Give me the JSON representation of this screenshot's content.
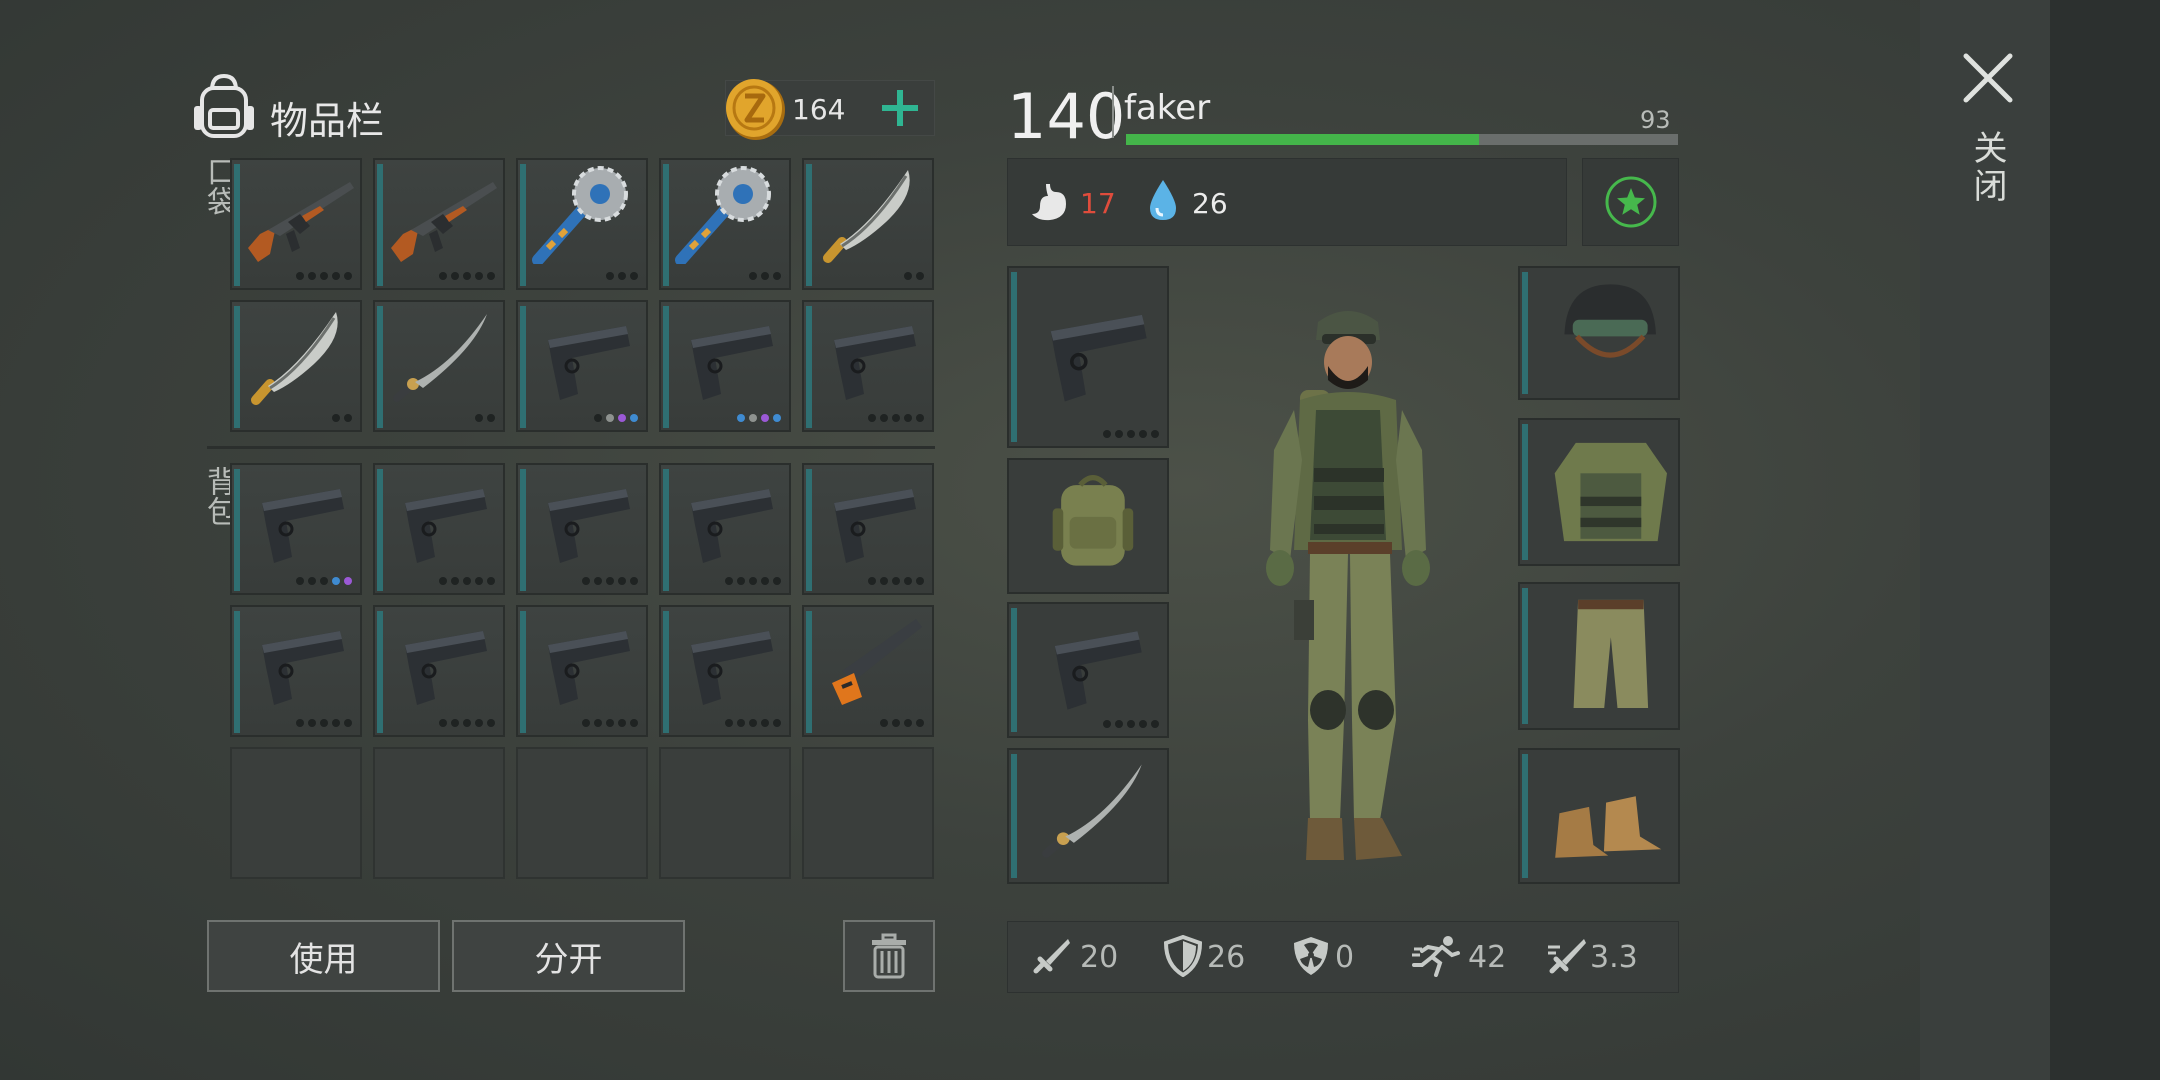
{
  "inventory": {
    "title": "物品栏",
    "coins": "164",
    "pocket_label": "口袋",
    "backpack_label": "背包",
    "pocket_slots": [
      {
        "item": "ak-rifle",
        "dots": [
          "d",
          "d",
          "d",
          "d",
          "d"
        ]
      },
      {
        "item": "ak-rifle",
        "dots": [
          "d",
          "d",
          "d",
          "d",
          "d"
        ]
      },
      {
        "item": "saw-club",
        "dots": [
          "d",
          "d",
          "d"
        ]
      },
      {
        "item": "saw-club",
        "dots": [
          "d",
          "d",
          "d"
        ]
      },
      {
        "item": "machete",
        "dots": [
          "d",
          "d"
        ]
      },
      {
        "item": "machete",
        "dots": [
          "d",
          "d"
        ]
      },
      {
        "item": "katana",
        "dots": [
          "d",
          "d"
        ]
      },
      {
        "item": "pistol",
        "dots": [
          "d",
          "gray",
          "purple",
          "blue"
        ]
      },
      {
        "item": "pistol",
        "dots": [
          "blue",
          "gray",
          "purple",
          "blue"
        ]
      },
      {
        "item": "pistol",
        "dots": [
          "d",
          "d",
          "d",
          "d",
          "d"
        ]
      }
    ],
    "backpack_slots": [
      {
        "item": "pistol",
        "dots": [
          "d",
          "d",
          "d",
          "blue",
          "purple"
        ]
      },
      {
        "item": "pistol",
        "dots": [
          "d",
          "d",
          "d",
          "d",
          "d"
        ]
      },
      {
        "item": "pistol",
        "dots": [
          "d",
          "d",
          "d",
          "d",
          "d"
        ]
      },
      {
        "item": "pistol",
        "dots": [
          "d",
          "d",
          "d",
          "d",
          "d"
        ]
      },
      {
        "item": "pistol",
        "dots": [
          "d",
          "d",
          "d",
          "d",
          "d"
        ]
      },
      {
        "item": "pistol",
        "dots": [
          "d",
          "d",
          "d",
          "d",
          "d"
        ]
      },
      {
        "item": "pistol",
        "dots": [
          "d",
          "d",
          "d",
          "d",
          "d"
        ]
      },
      {
        "item": "pistol",
        "dots": [
          "d",
          "d",
          "d",
          "d",
          "d"
        ]
      },
      {
        "item": "pistol",
        "dots": [
          "d",
          "d",
          "d",
          "d",
          "d"
        ]
      },
      {
        "item": "flare-gun",
        "dots": [
          "d",
          "d",
          "d",
          "d"
        ]
      },
      {
        "item": "",
        "dots": []
      },
      {
        "item": "",
        "dots": []
      },
      {
        "item": "",
        "dots": []
      },
      {
        "item": "",
        "dots": []
      },
      {
        "item": "",
        "dots": []
      }
    ],
    "use_label": "使用",
    "split_label": "分开",
    "trash_icon": "trash-icon"
  },
  "character": {
    "level": "140",
    "name": "faker",
    "xp_value": "93",
    "xp_fraction": 0.64,
    "hunger": "17",
    "thirst": "26",
    "hunger_color": "#e04c3c",
    "accent_green": "#44b54a",
    "left_equipment": [
      {
        "item": "pistol",
        "dots": [
          "d",
          "d",
          "d",
          "d",
          "d"
        ]
      },
      {
        "item": "backpack",
        "dots": []
      },
      {
        "item": "pistol",
        "dots": [
          "d",
          "d",
          "d",
          "d",
          "d"
        ]
      },
      {
        "item": "katana",
        "dots": []
      }
    ],
    "right_equipment": [
      {
        "item": "helmet"
      },
      {
        "item": "jacket"
      },
      {
        "item": "pants"
      },
      {
        "item": "boots"
      }
    ],
    "stats": {
      "damage": "20",
      "defense": "26",
      "radiation": "0",
      "speed": "42",
      "attack_speed": "3.3"
    }
  },
  "close_label": "关闭"
}
